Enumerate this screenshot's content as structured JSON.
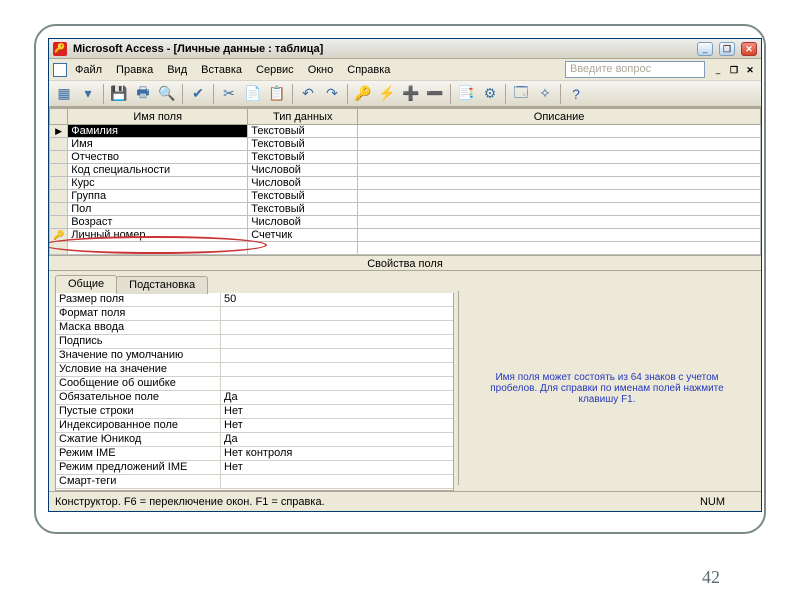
{
  "titlebar": {
    "appName": "Microsoft Access",
    "docName": "[Личные данные : таблица]"
  },
  "menu": {
    "file": "Файл",
    "edit": "Правка",
    "view": "Вид",
    "insert": "Вставка",
    "service": "Сервис",
    "window": "Окно",
    "help": "Справка"
  },
  "ask_placeholder": "Введите вопрос",
  "columns": {
    "fieldName": "Имя поля",
    "dataType": "Тип данных",
    "description": "Описание"
  },
  "rows": [
    {
      "sel": "▶",
      "name": "Фамилия",
      "type": "Текстовый",
      "selected": true
    },
    {
      "sel": "",
      "name": "Имя",
      "type": "Текстовый"
    },
    {
      "sel": "",
      "name": "Отчество",
      "type": "Текстовый"
    },
    {
      "sel": "",
      "name": "Код специальности",
      "type": "Числовой"
    },
    {
      "sel": "",
      "name": "Курс",
      "type": "Числовой"
    },
    {
      "sel": "",
      "name": "Группа",
      "type": "Текстовый"
    },
    {
      "sel": "",
      "name": "Пол",
      "type": "Текстовый"
    },
    {
      "sel": "",
      "name": "Возраст",
      "type": "Числовой"
    },
    {
      "sel": "🔑",
      "name": "Личный номер",
      "type": "Счетчик"
    }
  ],
  "propsHeader": "Свойства поля",
  "tabs": {
    "general": "Общие",
    "lookup": "Подстановка"
  },
  "props": [
    {
      "label": "Размер поля",
      "value": "50"
    },
    {
      "label": "Формат поля",
      "value": ""
    },
    {
      "label": "Маска ввода",
      "value": ""
    },
    {
      "label": "Подпись",
      "value": ""
    },
    {
      "label": "Значение по умолчанию",
      "value": ""
    },
    {
      "label": "Условие на значение",
      "value": ""
    },
    {
      "label": "Сообщение об ошибке",
      "value": ""
    },
    {
      "label": "Обязательное поле",
      "value": "Да"
    },
    {
      "label": "Пустые строки",
      "value": "Нет"
    },
    {
      "label": "Индексированное поле",
      "value": "Нет"
    },
    {
      "label": "Сжатие Юникод",
      "value": "Да"
    },
    {
      "label": "Режим IME",
      "value": "Нет контроля"
    },
    {
      "label": "Режим предложений IME",
      "value": "Нет"
    },
    {
      "label": "Смарт-теги",
      "value": ""
    }
  ],
  "help_text": "Имя поля может состоять из 64 знаков с учетом пробелов.  Для справки по именам полей нажмите клавишу F1.",
  "status": {
    "left": "Конструктор.  F6 = переключение окон.  F1 = справка.",
    "caps": "NUM"
  },
  "slide_number": "42"
}
